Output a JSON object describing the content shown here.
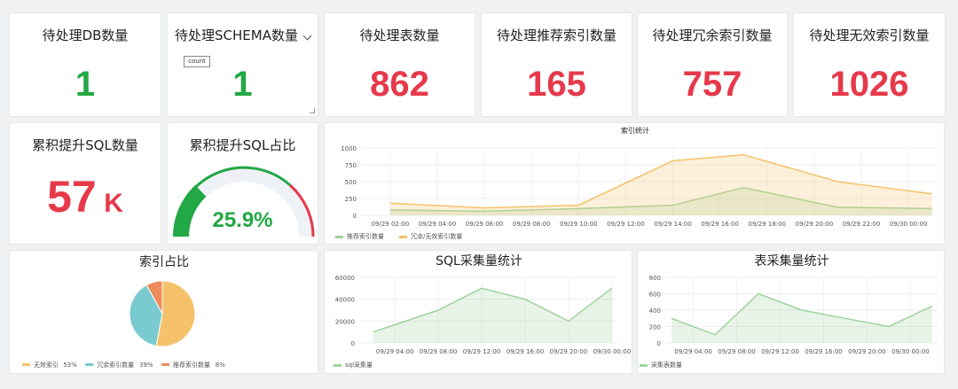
{
  "cards": [
    {
      "title": "待处理DB数量",
      "value": "1",
      "color": "#22a845"
    },
    {
      "title": "待处理SCHEMA数量",
      "value": "1",
      "color": "#22a845",
      "tag": "count"
    },
    {
      "title": "待处理表数量",
      "value": "862",
      "color": "#e6394a"
    },
    {
      "title": "待处理推荐索引数量",
      "value": "165",
      "color": "#e6394a"
    },
    {
      "title": "待处理冗余索引数量",
      "value": "757",
      "color": "#e6394a"
    },
    {
      "title": "待处理无效索引数量",
      "value": "1026",
      "color": "#e6394a"
    }
  ],
  "sql_total": {
    "title": "累积提升SQL数量",
    "value": "57",
    "unit": "K",
    "color": "#e6394a"
  },
  "sql_ratio": {
    "title": "累积提升SQL占比",
    "value": "25.9%",
    "fraction": 0.259,
    "color": "#22a845"
  },
  "colors": {
    "green": "#22a845",
    "red": "#e6394a",
    "orange": "#f5c26b",
    "teal": "#7acbd0",
    "coral": "#ee8b5c",
    "line_green": "#9ed39e"
  },
  "chart_data": [
    {
      "id": "index-stats",
      "type": "area",
      "title": "索引统计",
      "x": [
        "09/29 02:00",
        "09/29 04:00",
        "09/29 06:00",
        "09/29 08:00",
        "09/29 10:00",
        "09/29 12:00",
        "09/29 14:00",
        "09/29 16:00",
        "09/29 18:00",
        "09/29 20:00",
        "09/29 22:00",
        "09/30 00:00"
      ],
      "yticks": [
        0,
        250,
        500,
        750,
        1000
      ],
      "ylim": [
        0,
        1000
      ],
      "series": [
        {
          "name": "推荐索引数量",
          "color": "#9ed39e",
          "points": [
            [
              "09/29 02:00",
              80
            ],
            [
              "09/29 06:00",
              60
            ],
            [
              "09/29 10:00",
              100
            ],
            [
              "09/29 14:00",
              150
            ],
            [
              "09/29 17:00",
              410
            ],
            [
              "09/29 21:00",
              120
            ],
            [
              "09/30 01:00",
              100
            ]
          ]
        },
        {
          "name": "冗余/无效索引数量",
          "color": "#f5c26b",
          "points": [
            [
              "09/29 02:00",
              180
            ],
            [
              "09/29 06:00",
              110
            ],
            [
              "09/29 10:00",
              150
            ],
            [
              "09/29 14:00",
              810
            ],
            [
              "09/29 17:00",
              900
            ],
            [
              "09/29 21:00",
              500
            ],
            [
              "09/30 01:00",
              320
            ]
          ]
        }
      ],
      "legend": "bottom-left"
    },
    {
      "id": "index-ratio",
      "type": "pie",
      "title": "索引占比",
      "slices": [
        {
          "label": "无效索引",
          "percent": "53%",
          "value": 53,
          "color": "#f5c26b"
        },
        {
          "label": "冗余索引数量",
          "percent": "39%",
          "value": 39,
          "color": "#7acbd0"
        },
        {
          "label": "推荐索引数量",
          "percent": "8%",
          "value": 8,
          "color": "#ee8b5c"
        }
      ],
      "legend": "bottom-left"
    },
    {
      "id": "sql-collect",
      "type": "area",
      "title": "SQL采集量统计",
      "x": [
        "09/29 04:00",
        "09/29 08:00",
        "09/29 12:00",
        "09/29 16:00",
        "09/29 20:00",
        "09/30 00:00"
      ],
      "yticks": [
        0,
        20000,
        40000,
        60000
      ],
      "ylim": [
        0,
        60000
      ],
      "series": [
        {
          "name": "sql采集量",
          "color": "#9ed39e",
          "points": [
            [
              "09/29 02:00",
              10000
            ],
            [
              "09/29 08:00",
              30000
            ],
            [
              "09/29 12:00",
              50000
            ],
            [
              "09/29 16:00",
              40000
            ],
            [
              "09/29 20:00",
              20000
            ],
            [
              "09/30 00:00",
              50000
            ]
          ]
        }
      ],
      "legend": "bottom-left"
    },
    {
      "id": "table-collect",
      "type": "area",
      "title": "表采集量统计",
      "x": [
        "09/29 04:00",
        "09/29 08:00",
        "09/29 12:00",
        "09/29 16:00",
        "09/29 20:00",
        "09/30 00:00"
      ],
      "yticks": [
        0,
        200,
        400,
        600,
        800
      ],
      "ylim": [
        0,
        800
      ],
      "series": [
        {
          "name": "采集表数量",
          "color": "#9ed39e",
          "points": [
            [
              "09/29 02:00",
              300
            ],
            [
              "09/29 06:00",
              100
            ],
            [
              "09/29 10:00",
              600
            ],
            [
              "09/29 14:00",
              400
            ],
            [
              "09/29 18:00",
              300
            ],
            [
              "09/29 22:00",
              200
            ],
            [
              "09/30 02:00",
              450
            ]
          ]
        }
      ],
      "legend": "bottom-left"
    }
  ]
}
